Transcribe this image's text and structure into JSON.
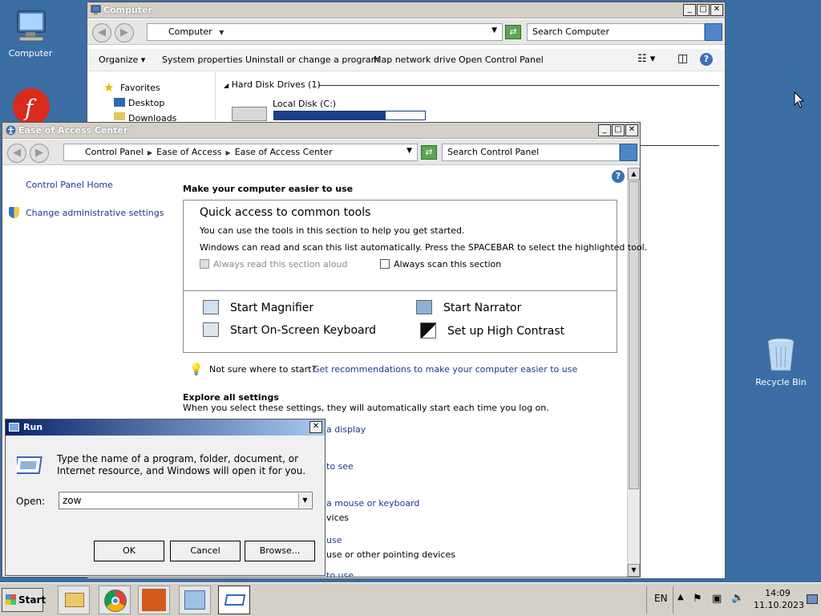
{
  "desktop": {
    "computer_label": "Computer",
    "recycle_label": "Recycle Bin"
  },
  "explorer": {
    "title": "Computer",
    "address": [
      "Computer"
    ],
    "search_placeholder": "Search Computer",
    "toolbar": {
      "organize": "Organize",
      "system_properties": "System properties",
      "uninstall": "Uninstall or change a program",
      "map_drive": "Map network drive",
      "open_cp": "Open Control Panel"
    },
    "nav": {
      "favorites": "Favorites",
      "desktop": "Desktop",
      "downloads": "Downloads"
    },
    "hdd_header": "Hard Disk Drives (1)",
    "disk_name": "Local Disk (C:)",
    "disk_used_fraction": 0.74
  },
  "eoa": {
    "title": "Ease of Access Center",
    "address": [
      "Control Panel",
      "Ease of Access",
      "Ease of Access Center"
    ],
    "search_placeholder": "Search Control Panel",
    "left": {
      "home": "Control Panel Home",
      "admin": "Change administrative settings"
    },
    "heading": "Make your computer easier to use",
    "quick": {
      "title": "Quick access to common tools",
      "line1": "You can use the tools in this section to help you get started.",
      "line2": "Windows can read and scan this list automatically.  Press the SPACEBAR to select the highlighted tool.",
      "read_aloud": "Always read this section aloud",
      "scan": "Always scan this section",
      "magnifier": "Start Magnifier",
      "narrator": "Start Narrator",
      "osk": "Start On-Screen Keyboard",
      "contrast": "Set up High Contrast"
    },
    "not_sure": "Not sure where to start?",
    "recommend": "Get recommendations to make your computer easier to use",
    "explore_title": "Explore all settings",
    "explore_sub": "When you select these settings, they will automatically start each time you log on.",
    "partial": {
      "p1": "a display",
      "p2": "to see",
      "p3": "a mouse or keyboard",
      "p4": "vices",
      "p5": "use",
      "p6": "use or other pointing devices",
      "p7": "to use"
    }
  },
  "run": {
    "title": "Run",
    "description": "Type the name of a program, folder, document, or Internet resource, and Windows will open it for you.",
    "open_label": "Open:",
    "open_value": "zow",
    "ok": "OK",
    "cancel": "Cancel",
    "browse": "Browse..."
  },
  "taskbar": {
    "start": "Start",
    "lang": "EN",
    "time": "14:09",
    "date": "11.10.2023"
  }
}
